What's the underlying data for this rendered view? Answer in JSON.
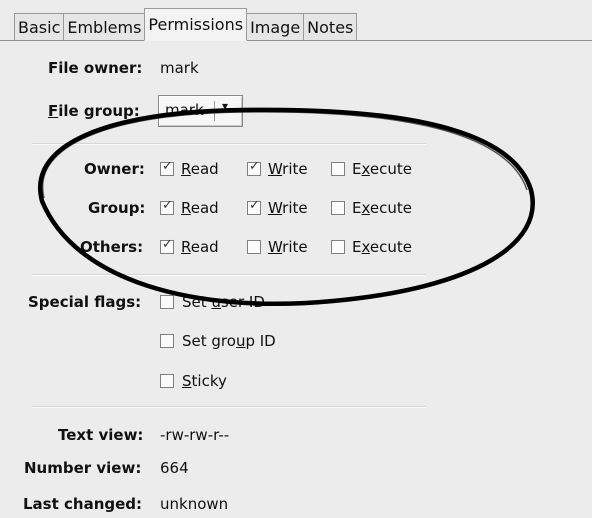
{
  "tabs": [
    {
      "label": "Basic"
    },
    {
      "label": "Emblems"
    },
    {
      "label": "Permissions",
      "active": true
    },
    {
      "label": "Image"
    },
    {
      "label": "Notes"
    }
  ],
  "file_owner": {
    "label": "File owner:",
    "value": "mark"
  },
  "file_group": {
    "label_first": "F",
    "label_rest": "ile group:",
    "value": "mark",
    "arrow": "▾"
  },
  "permissions": {
    "headers": [
      "Read",
      "Write",
      "Execute"
    ],
    "rows": [
      {
        "label": "Owner:",
        "read": {
          "checked": true,
          "pre": "",
          "mnemonic": "R",
          "post": "ead"
        },
        "write": {
          "checked": true,
          "pre": "",
          "mnemonic": "W",
          "post": "rite"
        },
        "execute": {
          "checked": false,
          "pre": "E",
          "mnemonic": "x",
          "post": "ecute"
        }
      },
      {
        "label": "Group:",
        "read": {
          "checked": true,
          "pre": "",
          "mnemonic": "R",
          "post": "ead"
        },
        "write": {
          "checked": true,
          "pre": "",
          "mnemonic": "W",
          "post": "rite"
        },
        "execute": {
          "checked": false,
          "pre": "E",
          "mnemonic": "x",
          "post": "ecute"
        }
      },
      {
        "label": "Others:",
        "read": {
          "checked": true,
          "pre": "",
          "mnemonic": "R",
          "post": "ead"
        },
        "write": {
          "checked": false,
          "pre": "",
          "mnemonic": "W",
          "post": "rite"
        },
        "execute": {
          "checked": false,
          "pre": "E",
          "mnemonic": "x",
          "post": "ecute"
        }
      }
    ]
  },
  "special_flags": {
    "label": "Special flags:",
    "items": [
      {
        "pre": "Set ",
        "mnemonic": "u",
        "post": "ser ID",
        "checked": false
      },
      {
        "pre": "Set gro",
        "mnemonic": "u",
        "post": "p ID",
        "checked": false
      },
      {
        "pre": "",
        "mnemonic": "S",
        "post": "ticky",
        "checked": false
      }
    ]
  },
  "text_view": {
    "label": "Text view:",
    "value": "-rw-rw-r--"
  },
  "number_view": {
    "label": "Number view:",
    "value": "664"
  },
  "last_changed": {
    "label": "Last changed:",
    "value": "unknown"
  }
}
